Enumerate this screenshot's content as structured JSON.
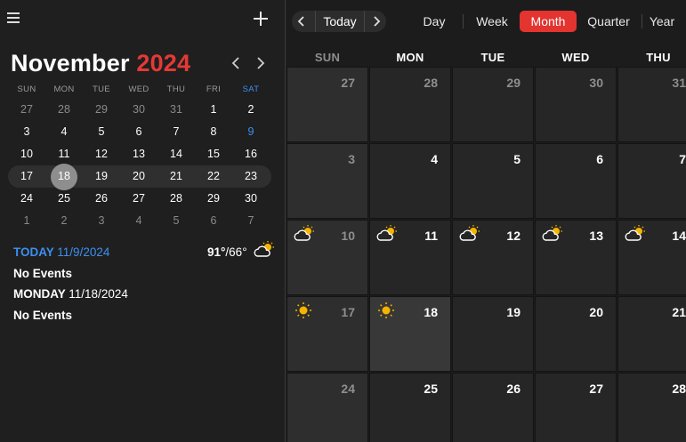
{
  "sidebar": {
    "month_name": "November",
    "year": "2024",
    "dow": [
      "SUN",
      "MON",
      "TUE",
      "WED",
      "THU",
      "FRI",
      "SAT"
    ],
    "weeks": [
      [
        {
          "d": "27",
          "dim": true
        },
        {
          "d": "28",
          "dim": true
        },
        {
          "d": "29",
          "dim": true
        },
        {
          "d": "30",
          "dim": true
        },
        {
          "d": "31",
          "dim": true
        },
        {
          "d": "1"
        },
        {
          "d": "2"
        }
      ],
      [
        {
          "d": "3"
        },
        {
          "d": "4"
        },
        {
          "d": "5"
        },
        {
          "d": "6"
        },
        {
          "d": "7"
        },
        {
          "d": "8"
        },
        {
          "d": "9",
          "sat": true
        }
      ],
      [
        {
          "d": "10"
        },
        {
          "d": "11"
        },
        {
          "d": "12"
        },
        {
          "d": "13"
        },
        {
          "d": "14"
        },
        {
          "d": "15"
        },
        {
          "d": "16"
        }
      ],
      [
        {
          "d": "17"
        },
        {
          "d": "18",
          "sel": true
        },
        {
          "d": "19"
        },
        {
          "d": "20"
        },
        {
          "d": "21"
        },
        {
          "d": "22"
        },
        {
          "d": "23"
        }
      ],
      [
        {
          "d": "24"
        },
        {
          "d": "25"
        },
        {
          "d": "26"
        },
        {
          "d": "27"
        },
        {
          "d": "28"
        },
        {
          "d": "29"
        },
        {
          "d": "30"
        }
      ],
      [
        {
          "d": "1",
          "dim": true
        },
        {
          "d": "2",
          "dim": true
        },
        {
          "d": "3",
          "dim": true
        },
        {
          "d": "4",
          "dim": true
        },
        {
          "d": "5",
          "dim": true
        },
        {
          "d": "6",
          "dim": true
        },
        {
          "d": "7",
          "dim": true
        }
      ]
    ],
    "current_week_index": 3,
    "agenda": {
      "today_label": "TODAY",
      "today_date": "11/9/2024",
      "today_events": "No Events",
      "temp_high": "91°",
      "temp_low": "/66°",
      "selected_label": "MONDAY",
      "selected_date": "11/18/2024",
      "selected_events": "No Events"
    }
  },
  "toolbar": {
    "today_label": "Today",
    "views": [
      "Day",
      "Week",
      "Month",
      "Quarter",
      "Year"
    ],
    "active_view": "Month"
  },
  "main": {
    "dow": [
      "SUN",
      "MON",
      "TUE",
      "WED",
      "THU"
    ],
    "weeks": [
      [
        {
          "d": "27",
          "dim": true
        },
        {
          "d": "28",
          "dim": true
        },
        {
          "d": "29",
          "dim": true
        },
        {
          "d": "30",
          "dim": true
        },
        {
          "d": "31",
          "dim": true
        }
      ],
      [
        {
          "d": "3"
        },
        {
          "d": "4"
        },
        {
          "d": "5"
        },
        {
          "d": "6"
        },
        {
          "d": "7"
        }
      ],
      [
        {
          "d": "10",
          "icon": "partly-cloudy-icon"
        },
        {
          "d": "11",
          "icon": "partly-cloudy-icon"
        },
        {
          "d": "12",
          "icon": "partly-cloudy-icon"
        },
        {
          "d": "13",
          "icon": "partly-cloudy-icon"
        },
        {
          "d": "14",
          "icon": "partly-cloudy-icon"
        }
      ],
      [
        {
          "d": "17",
          "icon": "sun-icon"
        },
        {
          "d": "18",
          "icon": "sun-icon",
          "highlight": true
        },
        {
          "d": "19"
        },
        {
          "d": "20"
        },
        {
          "d": "21"
        }
      ],
      [
        {
          "d": "24"
        },
        {
          "d": "25"
        },
        {
          "d": "26"
        },
        {
          "d": "27"
        },
        {
          "d": "28"
        }
      ]
    ]
  },
  "colors": {
    "accent_red": "#e33430",
    "saturday_blue": "#3d8ff0",
    "background": "#1f1f1f"
  }
}
